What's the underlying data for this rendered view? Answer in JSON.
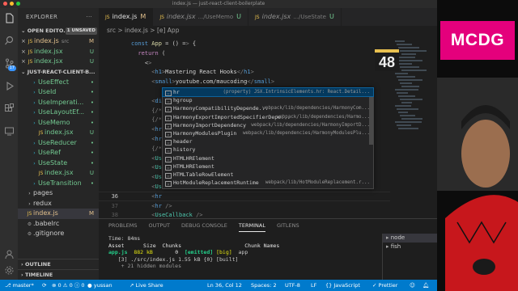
{
  "window": {
    "title": "index.js — just-react-client-boilerplate"
  },
  "activity": {
    "icons": [
      "files-icon",
      "search-icon",
      "source-control-icon",
      "run-debug-icon",
      "extensions-icon",
      "remote-icon",
      "account-icon",
      "settings-icon"
    ],
    "source_control_badge": "17"
  },
  "sidebar": {
    "title": "EXPLORER",
    "open_editors": {
      "label": "OPEN EDITO...",
      "unsaved": "1 UNSAVED"
    },
    "open_files": [
      {
        "name": "index.js",
        "sub": "src",
        "badge": "M",
        "modified": true
      },
      {
        "name": "index.jsx",
        "sub": "",
        "badge": "U",
        "modified": false
      },
      {
        "name": "index.jsx",
        "sub": "",
        "badge": "U",
        "modified": false
      }
    ],
    "project": "JUST-REACT-CLIENT-B...",
    "tree": [
      {
        "name": "UseEffect",
        "type": "folder",
        "badge": ""
      },
      {
        "name": "UseId",
        "type": "folder",
        "badge": ""
      },
      {
        "name": "UseImperati...",
        "type": "folder",
        "badge": ""
      },
      {
        "name": "UseLayoutEf...",
        "type": "folder",
        "badge": ""
      },
      {
        "name": "UseMemo",
        "type": "folder",
        "badge": ""
      },
      {
        "name": "index.jsx",
        "type": "file",
        "badge": "U"
      },
      {
        "name": "UseReducer",
        "type": "folder",
        "badge": ""
      },
      {
        "name": "UseRef",
        "type": "folder",
        "badge": ""
      },
      {
        "name": "UseState",
        "type": "folder",
        "badge": ""
      },
      {
        "name": "index.jsx",
        "type": "file",
        "badge": "U"
      },
      {
        "name": "UseTransition",
        "type": "folder",
        "badge": ""
      },
      {
        "name": "pages",
        "type": "folder-plain",
        "badge": ""
      },
      {
        "name": "redux",
        "type": "folder-plain",
        "badge": ""
      },
      {
        "name": "index.js",
        "type": "file-active",
        "badge": "M"
      },
      {
        "name": ".babelrc",
        "type": "file-plain",
        "badge": ""
      },
      {
        "name": ".gitignore",
        "type": "file-plain",
        "badge": ""
      }
    ],
    "outline": "OUTLINE",
    "timeline": "TIMELINE"
  },
  "tabs": [
    {
      "name": "index.js",
      "path": "",
      "mark": "M",
      "active": true
    },
    {
      "name": "index.jsx",
      "path": ".../UseMemo",
      "mark": "U",
      "active": false
    },
    {
      "name": "index.jsx",
      "path": ".../UseState",
      "mark": "U",
      "active": false
    }
  ],
  "breadcrumb": "src  >  index.js  >  [e] App",
  "editor": {
    "lines": [
      {
        "n": "",
        "text": "const App = () => {"
      },
      {
        "n": "",
        "text": "  return ("
      },
      {
        "n": "",
        "text": "    <>"
      },
      {
        "n": "",
        "text": "      <h1>Mastering React Hooks</h1>"
      },
      {
        "n": "",
        "text": "      <small>youtube.com/maucoding</small>"
      },
      {
        "n": "",
        "text": ""
      },
      {
        "n": "",
        "text": "      <div"
      },
      {
        "n": "",
        "text": "      {/*"
      },
      {
        "n": "",
        "text": "      {/*"
      },
      {
        "n": "",
        "text": "      <hr"
      },
      {
        "n": "",
        "text": "      <hr"
      },
      {
        "n": "",
        "text": "      {/*"
      },
      {
        "n": "",
        "text": "      <Us"
      },
      {
        "n": "",
        "text": "      <Us"
      },
      {
        "n": "",
        "text": "      <Us"
      },
      {
        "n": "",
        "text": "      <Us"
      },
      {
        "n": "36",
        "text": "      <hr"
      },
      {
        "n": "37",
        "text": "      <hr />"
      },
      {
        "n": "38",
        "text": "      <UseCallback />"
      }
    ]
  },
  "suggest": [
    {
      "label": "hr",
      "detail": "(property) JSX.IntrinsicElements.hr: React.Detail...",
      "kind": "property"
    },
    {
      "label": "hgroup",
      "detail": "",
      "kind": "property"
    },
    {
      "label": "HarmonyCompatibilityDepende...",
      "detail": "webpack/lib/dependencies/HarmonyCom...",
      "kind": "class"
    },
    {
      "label": "HarmonyExportImportedSpecifierDepe...",
      "detail": "webpack/lib/dependencies/Harmo...",
      "kind": "class"
    },
    {
      "label": "HarmonyImportDependency",
      "detail": "webpack/lib/dependencies/HarmonyImportD...",
      "kind": "class"
    },
    {
      "label": "HarmonyModulesPlugin",
      "detail": "webpack/lib/dependencies/HarmonyModulesPlu...",
      "kind": "class"
    },
    {
      "label": "header",
      "detail": "",
      "kind": "property"
    },
    {
      "label": "history",
      "detail": "",
      "kind": "variable"
    },
    {
      "label": "HTMLHRElement",
      "detail": "",
      "kind": "variable"
    },
    {
      "label": "HTMLHRElement",
      "detail": "",
      "kind": "variable"
    },
    {
      "label": "HTMLTableRowElement",
      "detail": "",
      "kind": "variable"
    },
    {
      "label": "HotModuleReplacementRuntime",
      "detail": "webpack/lib/HotModuleReplacement.r...",
      "kind": "class"
    }
  ],
  "panel": {
    "tabs": [
      "PROBLEMS",
      "OUTPUT",
      "DEBUG CONSOLE",
      "TERMINAL",
      "GITLENS"
    ],
    "active_tab": "TERMINAL",
    "terminal": {
      "time": "Time: 84ms",
      "header": "Asset      Size  Chunks                    Chunk Names",
      "asset": "app.js",
      "size": "882 kB",
      "chunk": "0",
      "emitted": "[emitted]",
      "big": "[big]",
      "chunk_name": "app",
      "module_line": "   [3] ./src/index.js 1.55 kB {0} [built]",
      "hidden": "    + 21 hidden modules"
    },
    "terminals": [
      "node",
      "fish"
    ]
  },
  "statusbar": {
    "branch": "master*",
    "errors": "0",
    "warnings": "0",
    "infos": "0",
    "user": "yussan",
    "live_share": "Live Share",
    "position": "Ln 36, Col 12",
    "spaces": "Spaces: 2",
    "encoding": "UTF-8",
    "eol": "LF",
    "language": "{} JavaScript",
    "prettier": "Prettier"
  },
  "overlay": {
    "logo": "MCDG",
    "counter": "48"
  },
  "colors": {
    "accent": "#007acc",
    "logo_bg": "#e4007c",
    "modified": "#e2c08d",
    "untracked": "#73c991"
  }
}
